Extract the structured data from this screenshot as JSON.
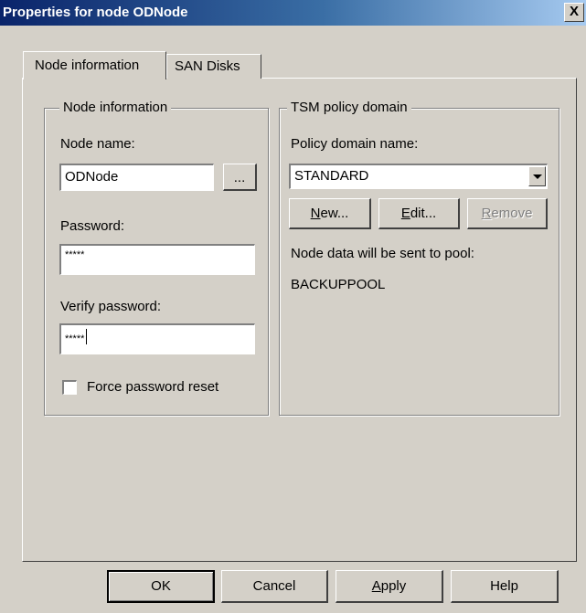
{
  "window": {
    "title": "Properties for node ODNode",
    "close_label": "X"
  },
  "tabs": [
    {
      "label": "Node information",
      "active": true
    },
    {
      "label": "SAN Disks",
      "active": false
    }
  ],
  "node_group": {
    "legend": "Node information",
    "node_name_label": "Node name:",
    "node_name_value": "ODNode",
    "browse_label": "...",
    "password_label": "Password:",
    "password_value": "*****",
    "verify_label": "Verify password:",
    "verify_value": "*****",
    "force_reset_label": "Force password reset",
    "force_reset_checked": false
  },
  "policy_group": {
    "legend": "TSM policy domain",
    "domain_label": "Policy domain name:",
    "domain_value": "STANDARD",
    "new_first": "N",
    "new_rest": "ew...",
    "edit_first": "E",
    "edit_rest": "dit...",
    "remove_first": "R",
    "remove_rest": "emove",
    "pool_text": "Node data will be sent to pool:",
    "pool_value": "BACKUPPOOL"
  },
  "footer": {
    "ok": "OK",
    "cancel": "Cancel",
    "apply_first": "A",
    "apply_rest": "pply",
    "help": "Help"
  },
  "colors": {
    "face": "#d4d0c8",
    "title_start": "#0a246a",
    "title_end": "#a6caf0"
  }
}
